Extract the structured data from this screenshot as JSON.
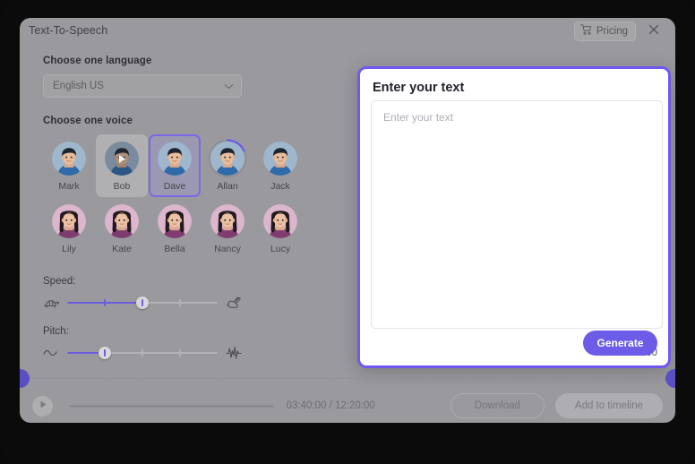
{
  "window": {
    "title": "Text-To-Speech",
    "pricing_label": "Pricing",
    "pricing_icon": "shopping-cart-icon",
    "close_icon": "close-icon"
  },
  "config": {
    "language_section_label": "Choose one language",
    "language_value": "English US",
    "language_chevron_icon": "chevron-down-icon",
    "voice_section_label": "Choose one voice",
    "voices": [
      {
        "name": "Mark",
        "gender": "male",
        "state": "default"
      },
      {
        "name": "Bob",
        "gender": "male",
        "state": "hovered"
      },
      {
        "name": "Dave",
        "gender": "male",
        "state": "selected"
      },
      {
        "name": "Allan",
        "gender": "male",
        "state": "loading"
      },
      {
        "name": "Jack",
        "gender": "male",
        "state": "default"
      },
      {
        "name": "Lily",
        "gender": "female",
        "state": "default"
      },
      {
        "name": "Kate",
        "gender": "female",
        "state": "default"
      },
      {
        "name": "Bella",
        "gender": "female",
        "state": "default"
      },
      {
        "name": "Nancy",
        "gender": "female",
        "state": "default"
      },
      {
        "name": "Lucy",
        "gender": "female",
        "state": "default"
      }
    ],
    "speed": {
      "label": "Speed:",
      "value_percent": 50,
      "left_icon": "turtle-icon",
      "right_icon": "rabbit-icon",
      "ticks_percent": [
        25,
        50,
        75
      ]
    },
    "pitch": {
      "label": "Pitch:",
      "value_percent": 25,
      "left_icon": "sine-wave-icon",
      "right_icon": "waveform-icon",
      "ticks_percent": [
        25,
        50,
        75
      ]
    }
  },
  "text_panel": {
    "title": "Enter your text",
    "textarea_value": "",
    "textarea_placeholder": "Enter your text",
    "char_counter": "0/2000",
    "generate_label": "Generate"
  },
  "player": {
    "play_icon": "play-icon",
    "progress_percent": 0,
    "time_display": "03:40:00 / 12:20:00",
    "current_time": "03:40:00",
    "total_time": "12:20:00",
    "download_label": "Download",
    "add_to_timeline_label": "Add to timeline"
  },
  "colors": {
    "accent_purple": "#6c5ce7",
    "panel_border_purple": "#7257f0",
    "handle_purple": "#5b4fc4",
    "app_surface": "#9a9a9e",
    "frame_dark": "#0b0b0c"
  }
}
